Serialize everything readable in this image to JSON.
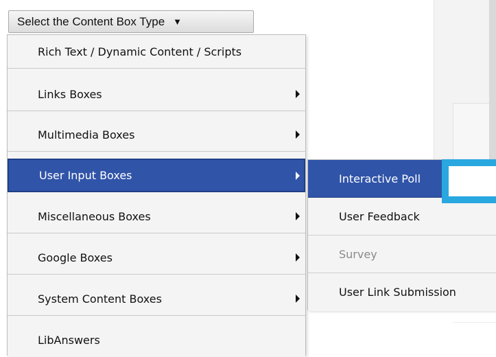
{
  "select": {
    "label": "Select the Content Box Type",
    "caret_icon": "triangle-down"
  },
  "menu": {
    "items": [
      {
        "label": "Rich Text / Dynamic Content / Scripts",
        "has_submenu": false
      },
      {
        "label": "Links Boxes",
        "has_submenu": true
      },
      {
        "label": "Multimedia Boxes",
        "has_submenu": true
      },
      {
        "label": "User Input Boxes",
        "has_submenu": true,
        "active": true
      },
      {
        "label": "Miscellaneous Boxes",
        "has_submenu": true
      },
      {
        "label": "Google Boxes",
        "has_submenu": true
      },
      {
        "label": "System Content Boxes",
        "has_submenu": true
      },
      {
        "label": "LibAnswers",
        "has_submenu": false
      }
    ]
  },
  "submenu": {
    "items": [
      {
        "label": "Interactive Poll",
        "active": true
      },
      {
        "label": "User Feedback"
      },
      {
        "label": "Survey",
        "disabled": true
      },
      {
        "label": "User Link Submission"
      }
    ]
  },
  "colors": {
    "highlight": "#3054a8",
    "annotation_arrow": "#29a8e0",
    "menu_bg": "#f4f4f4"
  }
}
